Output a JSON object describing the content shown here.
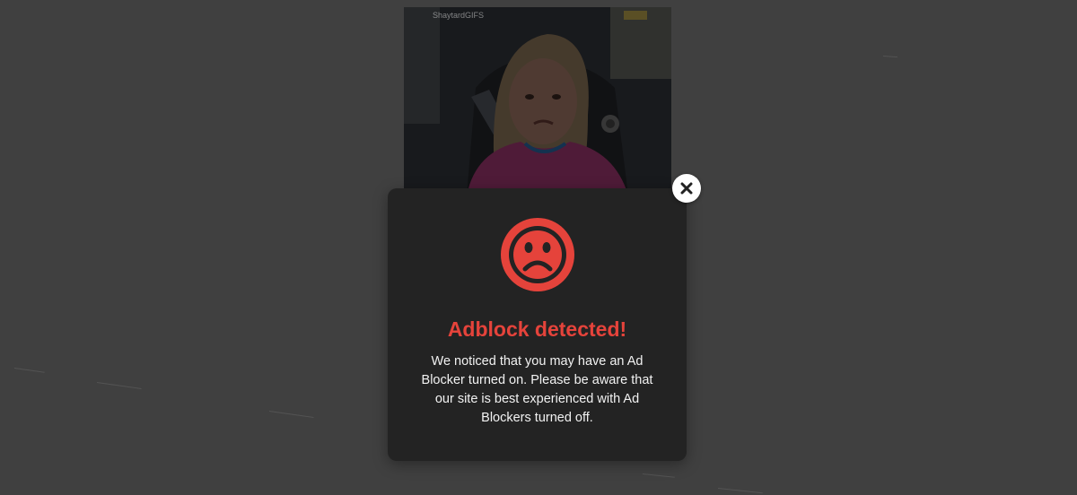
{
  "gif": {
    "watermark": "ShaytardGIFS"
  },
  "modal": {
    "icon": "sad-face-icon",
    "title": "Adblock detected!",
    "message": "We noticed that you may have an Ad Blocker turned on. Please be aware that our site is best experienced with Ad Blockers turned off.",
    "close_icon": "close-icon"
  },
  "colors": {
    "backdrop": "#404040",
    "modal_bg": "#232323",
    "accent": "#e5433b",
    "text": "#f2f2f2"
  }
}
